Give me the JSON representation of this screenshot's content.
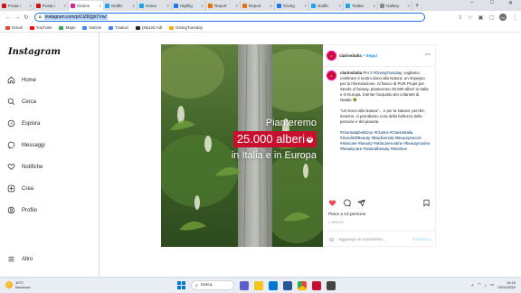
{
  "browser": {
    "tabs": [
      {
        "label": "Posta i",
        "color": "#c71610"
      },
      {
        "label": "Posta i",
        "color": "#c71610"
      },
      {
        "label": "Clarins",
        "color": "#d6249f",
        "active": true
      },
      {
        "label": "Notific",
        "color": "#1da1f2"
      },
      {
        "label": "Home",
        "color": "#1da1f2"
      },
      {
        "label": "Highlig",
        "color": "#1877f2"
      },
      {
        "label": "Report",
        "color": "#e8710a"
      },
      {
        "label": "Report",
        "color": "#e8710a"
      },
      {
        "label": "Giving",
        "color": "#1877f2"
      },
      {
        "label": "Notific",
        "color": "#1da1f2"
      },
      {
        "label": "Twitter",
        "color": "#1da1f2"
      },
      {
        "label": "Gallery",
        "color": "#888888"
      }
    ],
    "url": "instagram.com/p/ClZ8QjhTVw/",
    "profile_initial": "M",
    "bookmarks": [
      {
        "label": "Gmail",
        "color": "#ea4335"
      },
      {
        "label": "YouTube",
        "color": "#ff0000"
      },
      {
        "label": "Maps",
        "color": "#34a853"
      },
      {
        "label": "Notizie",
        "color": "#4285f4"
      },
      {
        "label": "Traduci",
        "color": "#4285f4"
      },
      {
        "label": "phpList Adl",
        "color": "#222222"
      },
      {
        "label": "GivingTuesday",
        "color": "#f9ab00"
      }
    ]
  },
  "instagram": {
    "logo": "Instagram",
    "nav": [
      {
        "label": "Home",
        "icon": "home-icon"
      },
      {
        "label": "Cerca",
        "icon": "search-icon"
      },
      {
        "label": "Esplora",
        "icon": "compass-icon"
      },
      {
        "label": "Messaggi",
        "icon": "messenger-icon"
      },
      {
        "label": "Notifiche",
        "icon": "heart-icon"
      },
      {
        "label": "Crea",
        "icon": "plus-icon"
      },
      {
        "label": "Profilo",
        "icon": "profile-icon"
      }
    ],
    "more": "Altro",
    "post": {
      "overlay_line1": "Pianteremo",
      "overlay_line2": "25.000 alberi",
      "overlay_line3": "in Italia e in Europa",
      "username": "clarinsitalia",
      "follow": "• Segui",
      "caption_p1_pre": "Per il ",
      "caption_p1_tag": "#GivingTuesday",
      "caption_p1_post": ", vogliamo celebrare il nostro dono alla Natura: un impegno per la riforestazione. Al fianco di PUR Projet per Seeds of beauty, pianteremo 25.000 alberi in Italia e in Europa, tramite l'acquisto dei cofanetti di Natale 🌳",
      "caption_p2": "\"Un Dono alla Natura\"... e per la Natura: perché, insieme, ci prendiamo cura della bellezza delle persone e del pianeta.",
      "hashtags": [
        "#GiornataDelDono",
        "#Clarins",
        "#ClarinsItalia",
        "#SeedsOfBeauty",
        "#Biodiversità",
        "#BeautySecret",
        "#skincare",
        "#beauty",
        "#skincareroutine",
        "#beautyroutine",
        "#beautycare",
        "#naturalbeauty",
        "#skinlove"
      ],
      "likes": "Piace a 13 persone",
      "date": "1 ORA FA",
      "comment_placeholder": "Aggiungi un commento...",
      "publish": "Pubblica"
    }
  },
  "taskbar": {
    "weather_temp": "10°C",
    "weather_desc": "Nuvoloso",
    "search_label": "Cerca",
    "time": "10:19",
    "date": "29/11/2022"
  }
}
